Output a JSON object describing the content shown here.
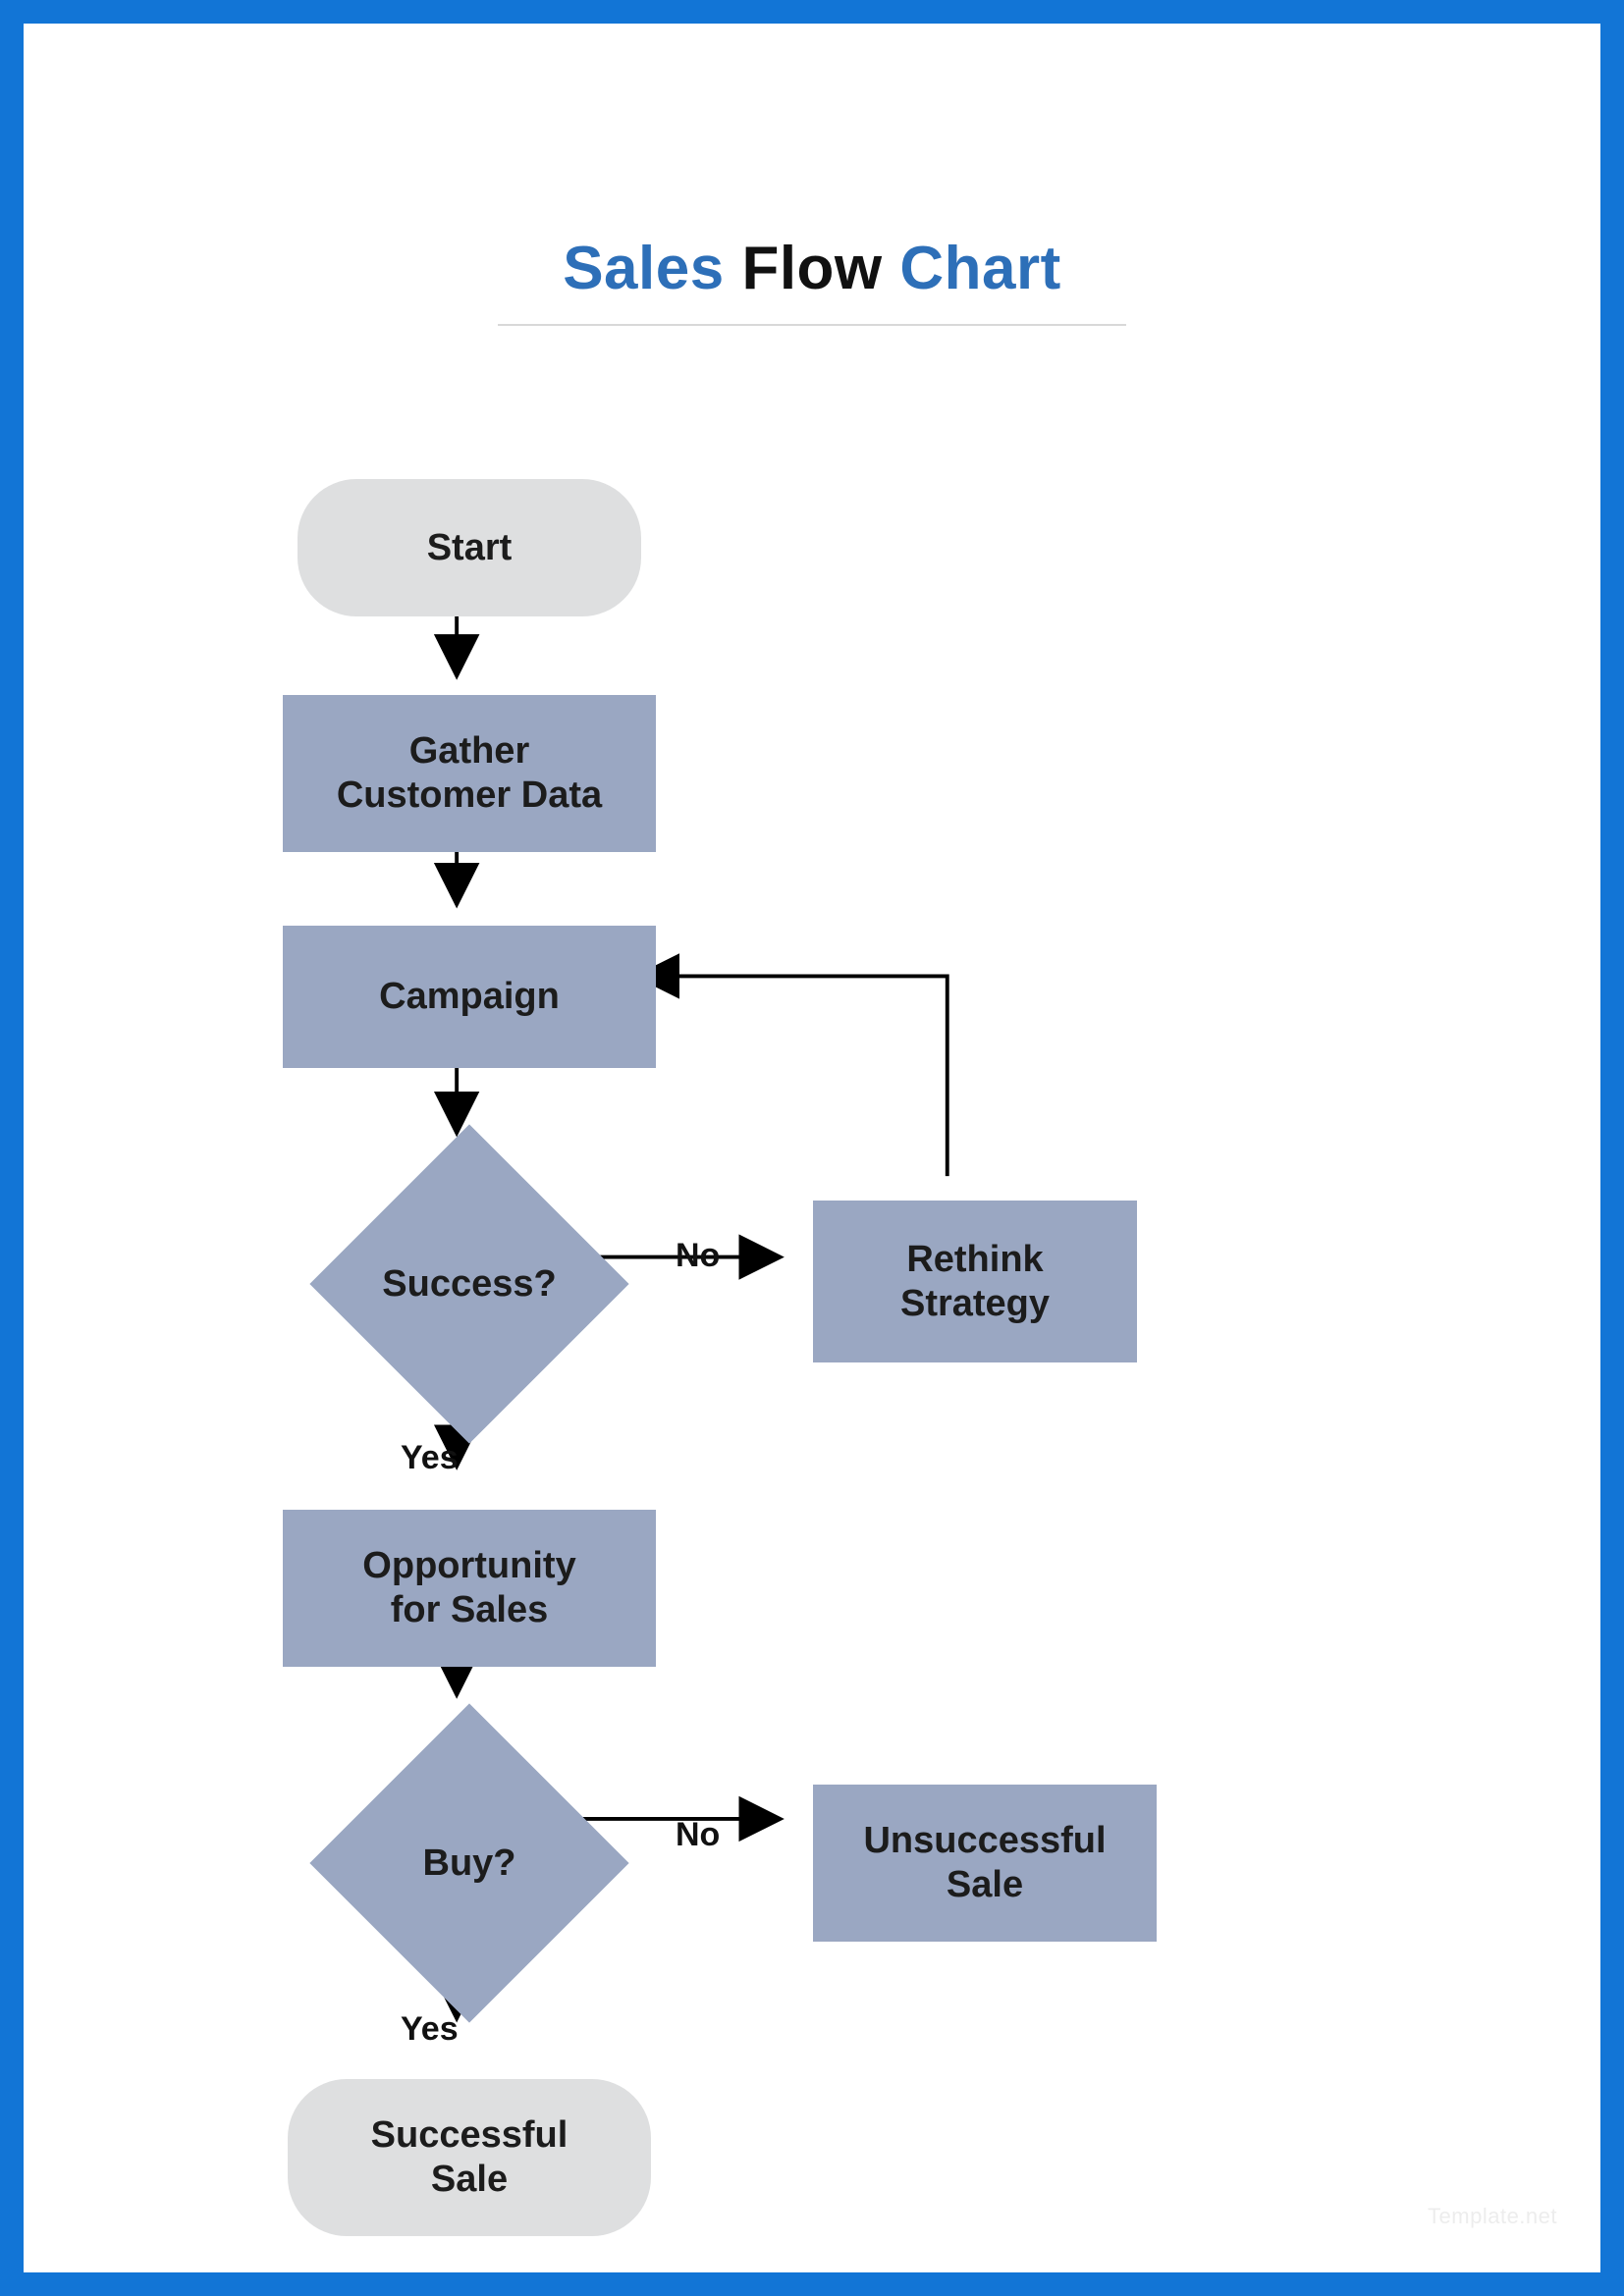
{
  "title": {
    "a": "Sales",
    "b": "Flow",
    "c": "Chart"
  },
  "nodes": {
    "start": {
      "label": "Start"
    },
    "gather": {
      "label": "Gather\nCustomer Data"
    },
    "campaign": {
      "label": "Campaign"
    },
    "success": {
      "label": "Success?"
    },
    "rethink": {
      "label": "Rethink\nStrategy"
    },
    "opportunity": {
      "label": "Opportunity\nfor Sales"
    },
    "buy": {
      "label": "Buy?"
    },
    "unsuccessful": {
      "label": "Unsuccessful\nSale"
    },
    "successful": {
      "label": "Successful\nSale"
    }
  },
  "edges": {
    "success_no": "No",
    "success_yes": "Yes",
    "buy_no": "No",
    "buy_yes": "Yes"
  },
  "watermark": "Template.net",
  "chart_data": {
    "type": "flowchart",
    "title": "Sales Flow Chart",
    "nodes": [
      {
        "id": "start",
        "type": "terminator",
        "label": "Start"
      },
      {
        "id": "gather",
        "type": "process",
        "label": "Gather Customer Data"
      },
      {
        "id": "campaign",
        "type": "process",
        "label": "Campaign"
      },
      {
        "id": "success",
        "type": "decision",
        "label": "Success?"
      },
      {
        "id": "rethink",
        "type": "process",
        "label": "Rethink Strategy"
      },
      {
        "id": "opportunity",
        "type": "process",
        "label": "Opportunity for Sales"
      },
      {
        "id": "buy",
        "type": "decision",
        "label": "Buy?"
      },
      {
        "id": "unsuccessful",
        "type": "process",
        "label": "Unsuccessful Sale"
      },
      {
        "id": "successful",
        "type": "terminator",
        "label": "Successful Sale"
      }
    ],
    "edges": [
      {
        "from": "start",
        "to": "gather",
        "label": ""
      },
      {
        "from": "gather",
        "to": "campaign",
        "label": ""
      },
      {
        "from": "campaign",
        "to": "success",
        "label": ""
      },
      {
        "from": "success",
        "to": "rethink",
        "label": "No"
      },
      {
        "from": "rethink",
        "to": "campaign",
        "label": ""
      },
      {
        "from": "success",
        "to": "opportunity",
        "label": "Yes"
      },
      {
        "from": "opportunity",
        "to": "buy",
        "label": ""
      },
      {
        "from": "buy",
        "to": "unsuccessful",
        "label": "No"
      },
      {
        "from": "buy",
        "to": "successful",
        "label": "Yes"
      }
    ]
  }
}
